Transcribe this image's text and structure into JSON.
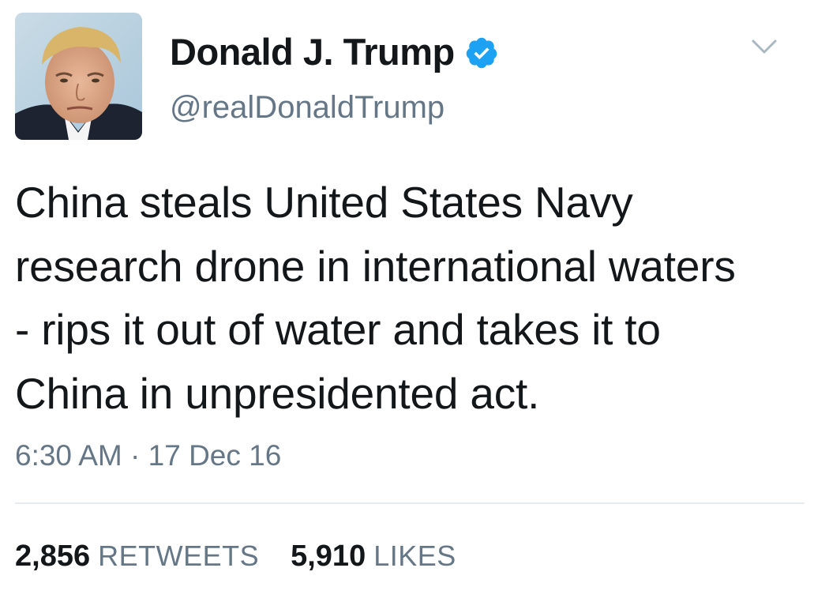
{
  "user": {
    "display_name": "Donald J. Trump",
    "handle": "@realDonaldTrump",
    "verified": true
  },
  "tweet": {
    "text": "China steals United States Navy\nresearch drone in international waters\n- rips it out of water and takes it to\nChina in unpresidented act.",
    "timestamp": "6:30 AM · 17 Dec 16"
  },
  "stats": {
    "retweets": {
      "count": "2,856",
      "label": "RETWEETS"
    },
    "likes": {
      "count": "5,910",
      "label": "LIKES"
    }
  },
  "colors": {
    "verified_badge": "#1DA1F2",
    "secondary_text": "#657786",
    "primary_text": "#14171A",
    "divider": "#E6ECF0"
  },
  "icons": [
    "avatar",
    "verified-badge-icon",
    "chevron-down-icon"
  ]
}
